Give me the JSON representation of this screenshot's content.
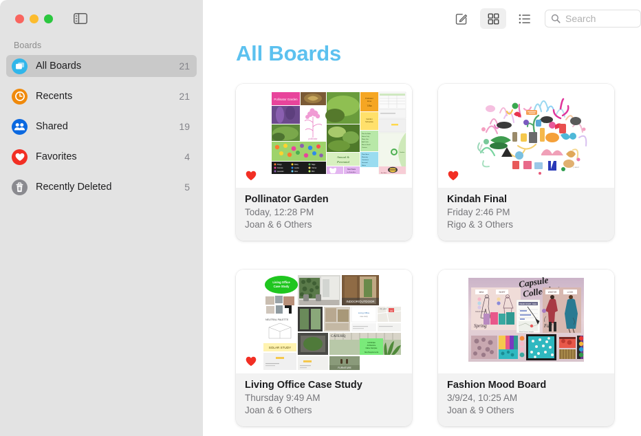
{
  "window": {
    "traffic_lights": [
      {
        "name": "close",
        "color": "#f9655f"
      },
      {
        "name": "minimize",
        "color": "#fcbc2e"
      },
      {
        "name": "zoom",
        "color": "#2bc73f"
      }
    ],
    "sidebar_toggle_icon": "sidebar-toggle-icon"
  },
  "sidebar": {
    "section_label": "Boards",
    "items": [
      {
        "label": "All Boards",
        "count": "21",
        "icon": "boards-icon",
        "color": "#31b6ea",
        "selected": true
      },
      {
        "label": "Recents",
        "count": "21",
        "icon": "clock-icon",
        "color": "#f08a0c",
        "selected": false
      },
      {
        "label": "Shared",
        "count": "19",
        "icon": "people-icon",
        "color": "#0a68e0",
        "selected": false
      },
      {
        "label": "Favorites",
        "count": "4",
        "icon": "heart-icon",
        "color": "#f22f24",
        "selected": false
      },
      {
        "label": "Recently Deleted",
        "count": "5",
        "icon": "trash-icon",
        "color": "#8a8a8f",
        "selected": false
      }
    ]
  },
  "toolbar": {
    "buttons": [
      {
        "name": "new-board-button",
        "icon": "compose-icon",
        "active": false
      },
      {
        "name": "grid-view-button",
        "icon": "grid-icon",
        "active": true
      },
      {
        "name": "list-view-button",
        "icon": "list-icon",
        "active": false
      }
    ],
    "search": {
      "placeholder": "Search",
      "value": "",
      "icon": "search-icon"
    }
  },
  "main": {
    "title": "All Boards",
    "title_color": "#5cc1ef",
    "boards": [
      {
        "title": "Pollinator Garden",
        "date": "Today, 12:28 PM",
        "people": "Joan & 6 Others",
        "favorite": true,
        "thumbnail": "pollinator-garden-thumbnail"
      },
      {
        "title": "Kindah Final",
        "date": "Friday 2:46 PM",
        "people": "Rigo & 3 Others",
        "favorite": true,
        "thumbnail": "kindah-final-thumbnail"
      },
      {
        "title": "Living Office Case Study",
        "date": "Thursday 9:49 AM",
        "people": "Joan & 6 Others",
        "favorite": true,
        "thumbnail": "living-office-thumbnail"
      },
      {
        "title": "Fashion Mood Board",
        "date": "3/9/24, 10:25 AM",
        "people": "Joan & 9 Others",
        "favorite": false,
        "thumbnail": "fashion-mood-board-thumbnail"
      }
    ]
  }
}
